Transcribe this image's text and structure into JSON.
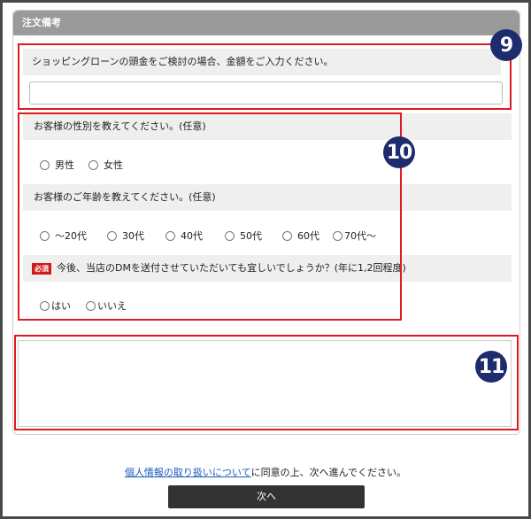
{
  "panel": {
    "title": "注文備考"
  },
  "q1": {
    "label": "ショッピングローンの頭金をご検討の場合、金額をご入力ください。",
    "value": ""
  },
  "q2": {
    "label": "お客様の性別を教えてください。(任意)",
    "options": [
      "男性",
      "女性"
    ]
  },
  "q3": {
    "label": "お客様のご年齢を教えてください。(任意)",
    "options": [
      "〜20代",
      "30代",
      "40代",
      "50代",
      "60代",
      "70代〜"
    ]
  },
  "q4": {
    "required_badge": "必須",
    "label": "今後、当店のDMを送付させていただいても宜しいでしょうか？(年に1,2回程度)",
    "options": [
      "はい",
      "いいえ"
    ]
  },
  "notes": {
    "value": ""
  },
  "badges": {
    "b9": "9",
    "b10": "10",
    "b11": "11"
  },
  "footer": {
    "link_text": "個人情報の取り扱いについて",
    "consent_text": "に同意の上、次へ進んでください。",
    "next_label": "次へ"
  },
  "colors": {
    "highlight": "#e01a22",
    "badge": "#1e2b6d",
    "header": "#9a9a9a",
    "button": "#333333",
    "link": "#1a5bbf",
    "required": "#d01818"
  }
}
